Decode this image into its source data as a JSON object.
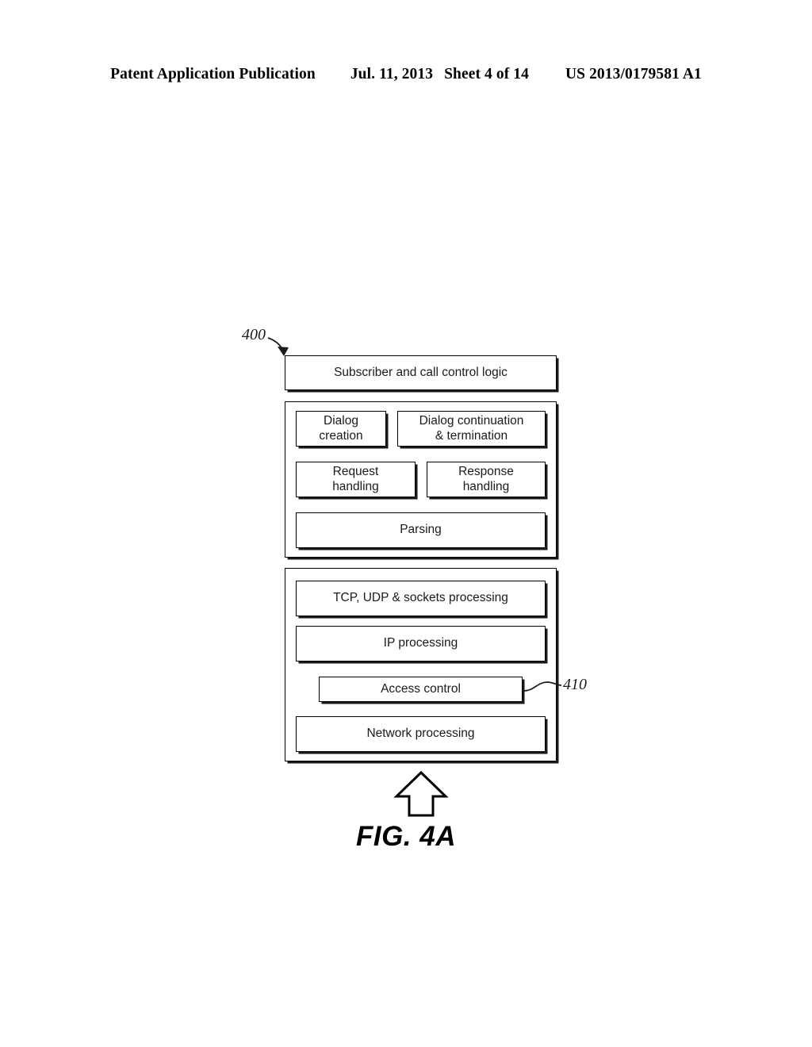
{
  "header": {
    "publication": "Patent Application Publication",
    "date": "Jul. 11, 2013",
    "sheet": "Sheet 4 of 14",
    "patent_number": "US 2013/0179581 A1"
  },
  "figure": {
    "caption": "FIG. 4A",
    "callouts": [
      {
        "id": "400",
        "label": "400"
      },
      {
        "id": "410",
        "label": "410"
      }
    ],
    "top_box": {
      "label": "Subscriber and call control logic"
    },
    "upper_group": {
      "boxes": [
        {
          "label": "Dialog\ncreation"
        },
        {
          "label": "Dialog continuation\n& termination"
        },
        {
          "label": "Request\nhandling"
        },
        {
          "label": "Response\nhandling"
        },
        {
          "label": "Parsing"
        }
      ]
    },
    "lower_group": {
      "boxes": [
        {
          "label": "TCP, UDP & sockets processing"
        },
        {
          "label": "IP processing"
        },
        {
          "label": "Access control"
        },
        {
          "label": "Network processing"
        }
      ]
    },
    "arrow": {
      "direction": "up"
    }
  },
  "colors": {
    "ink": "#000000",
    "text": "#1a1a1a",
    "paper": "#ffffff"
  }
}
